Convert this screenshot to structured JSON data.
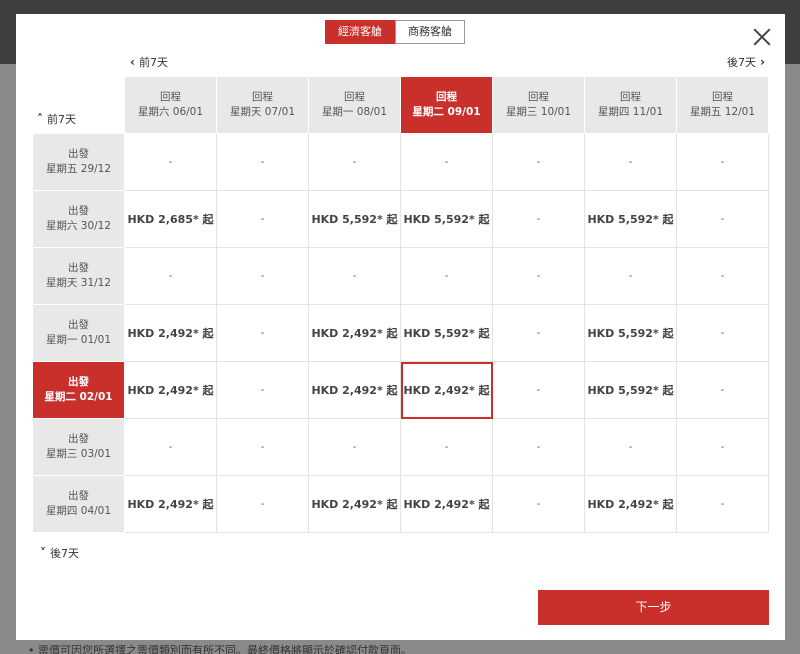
{
  "background": {
    "footer_note": "• 票價可因您所選擇之票價類別而有所不同。最終價格將顯示於確認付款頁面。"
  },
  "cabin_tabs": {
    "economy": "經濟客艙",
    "business": "商務客艙"
  },
  "nav": {
    "prev_top": "前7天",
    "next_top": "後7天",
    "prev_side": "前7天",
    "next_side": "後7天"
  },
  "return_columns": [
    {
      "label": "回程",
      "date": "星期六 06/01",
      "selected": false
    },
    {
      "label": "回程",
      "date": "星期天 07/01",
      "selected": false
    },
    {
      "label": "回程",
      "date": "星期一 08/01",
      "selected": false
    },
    {
      "label": "回程",
      "date": "星期二 09/01",
      "selected": true
    },
    {
      "label": "回程",
      "date": "星期三 10/01",
      "selected": false
    },
    {
      "label": "回程",
      "date": "星期四 11/01",
      "selected": false
    },
    {
      "label": "回程",
      "date": "星期五 12/01",
      "selected": false
    }
  ],
  "departure_rows": [
    {
      "label": "出發",
      "date": "星期五 29/12",
      "selected": false,
      "prices": [
        "-",
        "-",
        "-",
        "-",
        "-",
        "-",
        "-"
      ]
    },
    {
      "label": "出發",
      "date": "星期六 30/12",
      "selected": false,
      "prices": [
        "HKD 2,685* 起",
        "-",
        "HKD 5,592* 起",
        "HKD 5,592* 起",
        "-",
        "HKD 5,592* 起",
        "-"
      ]
    },
    {
      "label": "出發",
      "date": "星期天 31/12",
      "selected": false,
      "prices": [
        "-",
        "-",
        "-",
        "-",
        "-",
        "-",
        "-"
      ]
    },
    {
      "label": "出發",
      "date": "星期一 01/01",
      "selected": false,
      "prices": [
        "HKD 2,492* 起",
        "-",
        "HKD 2,492* 起",
        "HKD 5,592* 起",
        "-",
        "HKD 5,592* 起",
        "-"
      ]
    },
    {
      "label": "出發",
      "date": "星期二 02/01",
      "selected": true,
      "prices": [
        "HKD 2,492* 起",
        "-",
        "HKD 2,492* 起",
        "HKD 2,492* 起",
        "-",
        "HKD 5,592* 起",
        "-"
      ]
    },
    {
      "label": "出發",
      "date": "星期三 03/01",
      "selected": false,
      "prices": [
        "-",
        "-",
        "-",
        "-",
        "-",
        "-",
        "-"
      ]
    },
    {
      "label": "出發",
      "date": "星期四 04/01",
      "selected": false,
      "prices": [
        "HKD 2,492* 起",
        "-",
        "HKD 2,492* 起",
        "HKD 2,492* 起",
        "-",
        "HKD 2,492* 起",
        "-"
      ]
    }
  ],
  "selected_cell": {
    "row": 4,
    "col": 3
  },
  "next_button": "下一步",
  "colors": {
    "accent": "#c9302c",
    "header_bg": "#e8e8e8"
  }
}
